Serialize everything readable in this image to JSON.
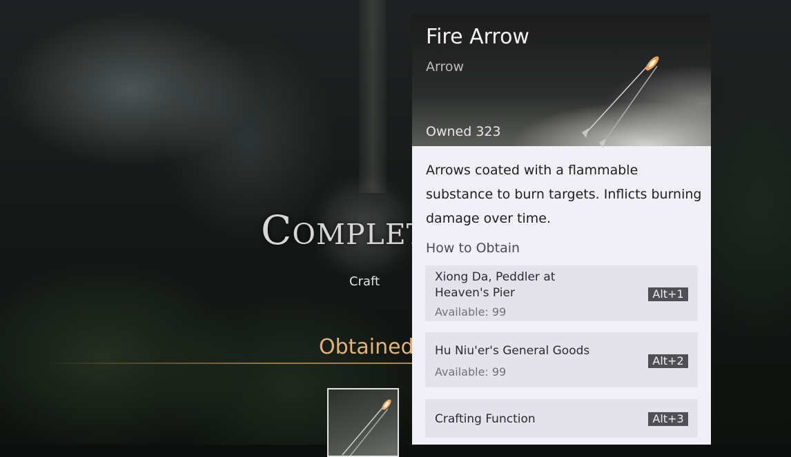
{
  "background": {
    "completed_label": "Completed",
    "craft_label": "Craft",
    "obtained_label": "Obtained"
  },
  "item": {
    "name": "Fire Arrow",
    "type": "Arrow",
    "owned_label": "Owned",
    "owned_count": "323",
    "description": "Arrows coated with a flammable substance to burn targets. Inflicts burning damage over time."
  },
  "how_to_obtain": {
    "title": "How to Obtain",
    "sources": [
      {
        "name_line1": "Xiong Da, Peddler at",
        "name_line2": "Heaven's Pier",
        "available": "Available: 99",
        "key": "Alt+1"
      },
      {
        "name": "Hu Niu'er's General Goods",
        "available": "Available: 99",
        "key": "Alt+2"
      },
      {
        "name": "Crafting Function",
        "key": "Alt+3"
      }
    ]
  },
  "colors": {
    "obtained_accent": "#e6b27a",
    "panel_bg": "#f1f0f6",
    "key_bg": "#4f4f56"
  },
  "icons": [
    "fire-arrow-icon",
    "emblem-icon"
  ]
}
